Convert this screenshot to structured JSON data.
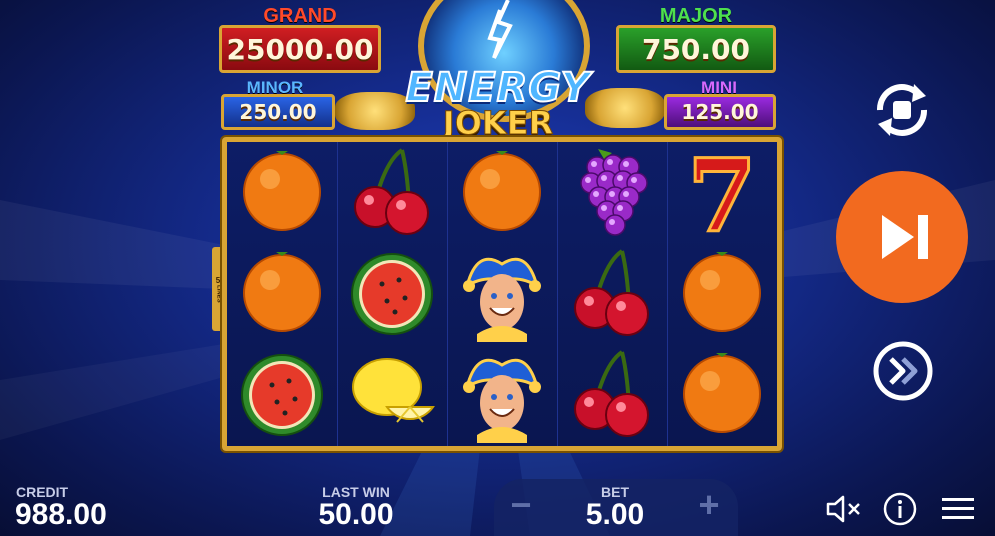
{
  "jackpots": {
    "grand": {
      "label": "GRAND",
      "value": "25000.00"
    },
    "major": {
      "label": "MAJOR",
      "value": "750.00"
    },
    "minor": {
      "label": "MINOR",
      "value": "250.00"
    },
    "mini": {
      "label": "MINI",
      "value": "125.00"
    }
  },
  "logo": {
    "line1": "ENERGY",
    "line2": "JOKER"
  },
  "paylines": {
    "count": "5",
    "label": "LINES"
  },
  "reels": [
    [
      "orange",
      "orange",
      "watermelon"
    ],
    [
      "cherry",
      "watermelon",
      "lemon"
    ],
    [
      "orange",
      "joker",
      "joker"
    ],
    [
      "grapes",
      "cherry",
      "cherry"
    ],
    [
      "seven",
      "orange",
      "orange"
    ]
  ],
  "controls": {
    "autoplay_icon": "autoplay-icon",
    "spin_icon": "spin-skip-icon",
    "turbo_icon": "turbo-icon"
  },
  "footer": {
    "credit_label": "CREDIT",
    "credit_value": "988.00",
    "last_win_label": "LAST WIN",
    "last_win_value": "50.00",
    "bet_label": "BET",
    "bet_value": "5.00",
    "minus": "−",
    "plus": "+",
    "sound_icon": "sound-muted-icon",
    "info_icon": "info-icon",
    "menu_icon": "menu-icon"
  },
  "colors": {
    "gold": "#d9a534",
    "grand_plate": "#b3141a",
    "major_plate": "#1f8a1f",
    "minor_plate": "#1a4fd6",
    "mini_plate": "#7a1fb3",
    "spin_button": "#f26a1f"
  }
}
